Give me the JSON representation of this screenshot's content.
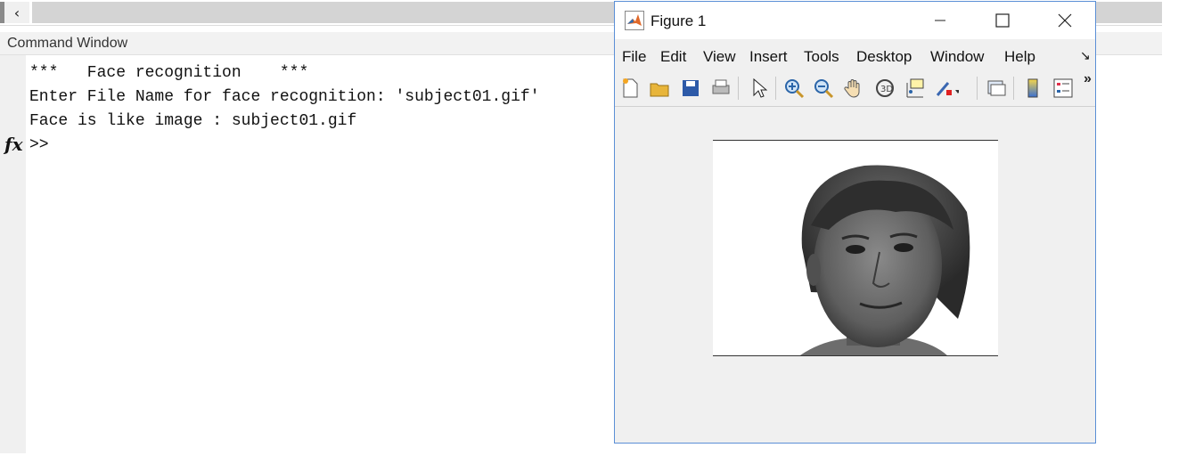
{
  "command_window": {
    "title": "Command Window",
    "lines": [
      "***   Face recognition    ***",
      "Enter File Name for face recognition: 'subject01.gif'",
      "Face is like image : subject01.gif"
    ],
    "prompt": ">>",
    "fx": "fx"
  },
  "figure": {
    "title": "Figure 1",
    "menu": [
      "File",
      "Edit",
      "View",
      "Insert",
      "Tools",
      "Desktop",
      "Window",
      "Help"
    ],
    "toolbar_icons": [
      "new-figure-icon",
      "open-file-icon",
      "save-icon",
      "print-icon",
      "pointer-icon",
      "zoom-in-icon",
      "zoom-out-icon",
      "pan-hand-icon",
      "rotate-3d-icon",
      "data-cursor-icon",
      "brush-icon",
      "link-plot-icon",
      "colorbar-icon",
      "legend-icon"
    ],
    "more_label": "»",
    "image_description_label": ""
  }
}
